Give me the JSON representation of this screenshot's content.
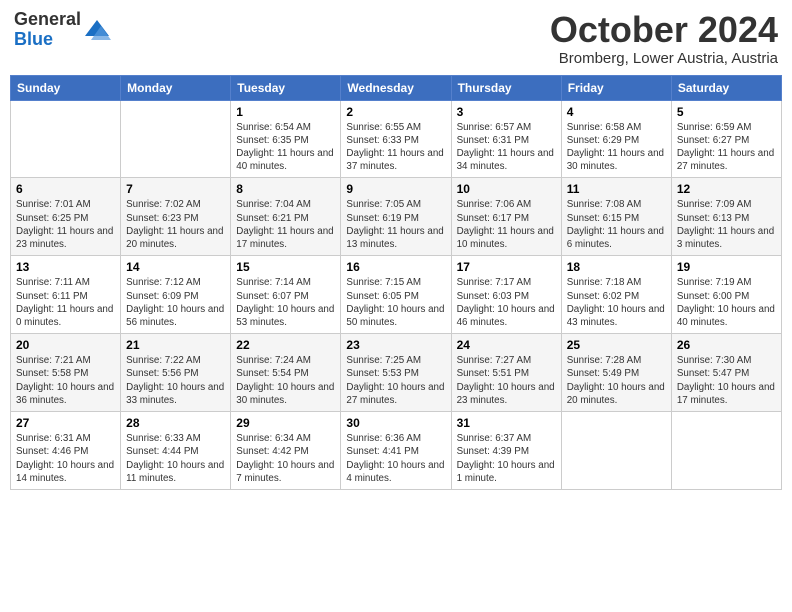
{
  "header": {
    "logo_line1": "General",
    "logo_line2": "Blue",
    "title": "October 2024",
    "subtitle": "Bromberg, Lower Austria, Austria"
  },
  "days_of_week": [
    "Sunday",
    "Monday",
    "Tuesday",
    "Wednesday",
    "Thursday",
    "Friday",
    "Saturday"
  ],
  "weeks": [
    [
      {
        "num": "",
        "info": ""
      },
      {
        "num": "",
        "info": ""
      },
      {
        "num": "1",
        "info": "Sunrise: 6:54 AM\nSunset: 6:35 PM\nDaylight: 11 hours and 40 minutes."
      },
      {
        "num": "2",
        "info": "Sunrise: 6:55 AM\nSunset: 6:33 PM\nDaylight: 11 hours and 37 minutes."
      },
      {
        "num": "3",
        "info": "Sunrise: 6:57 AM\nSunset: 6:31 PM\nDaylight: 11 hours and 34 minutes."
      },
      {
        "num": "4",
        "info": "Sunrise: 6:58 AM\nSunset: 6:29 PM\nDaylight: 11 hours and 30 minutes."
      },
      {
        "num": "5",
        "info": "Sunrise: 6:59 AM\nSunset: 6:27 PM\nDaylight: 11 hours and 27 minutes."
      }
    ],
    [
      {
        "num": "6",
        "info": "Sunrise: 7:01 AM\nSunset: 6:25 PM\nDaylight: 11 hours and 23 minutes."
      },
      {
        "num": "7",
        "info": "Sunrise: 7:02 AM\nSunset: 6:23 PM\nDaylight: 11 hours and 20 minutes."
      },
      {
        "num": "8",
        "info": "Sunrise: 7:04 AM\nSunset: 6:21 PM\nDaylight: 11 hours and 17 minutes."
      },
      {
        "num": "9",
        "info": "Sunrise: 7:05 AM\nSunset: 6:19 PM\nDaylight: 11 hours and 13 minutes."
      },
      {
        "num": "10",
        "info": "Sunrise: 7:06 AM\nSunset: 6:17 PM\nDaylight: 11 hours and 10 minutes."
      },
      {
        "num": "11",
        "info": "Sunrise: 7:08 AM\nSunset: 6:15 PM\nDaylight: 11 hours and 6 minutes."
      },
      {
        "num": "12",
        "info": "Sunrise: 7:09 AM\nSunset: 6:13 PM\nDaylight: 11 hours and 3 minutes."
      }
    ],
    [
      {
        "num": "13",
        "info": "Sunrise: 7:11 AM\nSunset: 6:11 PM\nDaylight: 11 hours and 0 minutes."
      },
      {
        "num": "14",
        "info": "Sunrise: 7:12 AM\nSunset: 6:09 PM\nDaylight: 10 hours and 56 minutes."
      },
      {
        "num": "15",
        "info": "Sunrise: 7:14 AM\nSunset: 6:07 PM\nDaylight: 10 hours and 53 minutes."
      },
      {
        "num": "16",
        "info": "Sunrise: 7:15 AM\nSunset: 6:05 PM\nDaylight: 10 hours and 50 minutes."
      },
      {
        "num": "17",
        "info": "Sunrise: 7:17 AM\nSunset: 6:03 PM\nDaylight: 10 hours and 46 minutes."
      },
      {
        "num": "18",
        "info": "Sunrise: 7:18 AM\nSunset: 6:02 PM\nDaylight: 10 hours and 43 minutes."
      },
      {
        "num": "19",
        "info": "Sunrise: 7:19 AM\nSunset: 6:00 PM\nDaylight: 10 hours and 40 minutes."
      }
    ],
    [
      {
        "num": "20",
        "info": "Sunrise: 7:21 AM\nSunset: 5:58 PM\nDaylight: 10 hours and 36 minutes."
      },
      {
        "num": "21",
        "info": "Sunrise: 7:22 AM\nSunset: 5:56 PM\nDaylight: 10 hours and 33 minutes."
      },
      {
        "num": "22",
        "info": "Sunrise: 7:24 AM\nSunset: 5:54 PM\nDaylight: 10 hours and 30 minutes."
      },
      {
        "num": "23",
        "info": "Sunrise: 7:25 AM\nSunset: 5:53 PM\nDaylight: 10 hours and 27 minutes."
      },
      {
        "num": "24",
        "info": "Sunrise: 7:27 AM\nSunset: 5:51 PM\nDaylight: 10 hours and 23 minutes."
      },
      {
        "num": "25",
        "info": "Sunrise: 7:28 AM\nSunset: 5:49 PM\nDaylight: 10 hours and 20 minutes."
      },
      {
        "num": "26",
        "info": "Sunrise: 7:30 AM\nSunset: 5:47 PM\nDaylight: 10 hours and 17 minutes."
      }
    ],
    [
      {
        "num": "27",
        "info": "Sunrise: 6:31 AM\nSunset: 4:46 PM\nDaylight: 10 hours and 14 minutes."
      },
      {
        "num": "28",
        "info": "Sunrise: 6:33 AM\nSunset: 4:44 PM\nDaylight: 10 hours and 11 minutes."
      },
      {
        "num": "29",
        "info": "Sunrise: 6:34 AM\nSunset: 4:42 PM\nDaylight: 10 hours and 7 minutes."
      },
      {
        "num": "30",
        "info": "Sunrise: 6:36 AM\nSunset: 4:41 PM\nDaylight: 10 hours and 4 minutes."
      },
      {
        "num": "31",
        "info": "Sunrise: 6:37 AM\nSunset: 4:39 PM\nDaylight: 10 hours and 1 minute."
      },
      {
        "num": "",
        "info": ""
      },
      {
        "num": "",
        "info": ""
      }
    ]
  ]
}
